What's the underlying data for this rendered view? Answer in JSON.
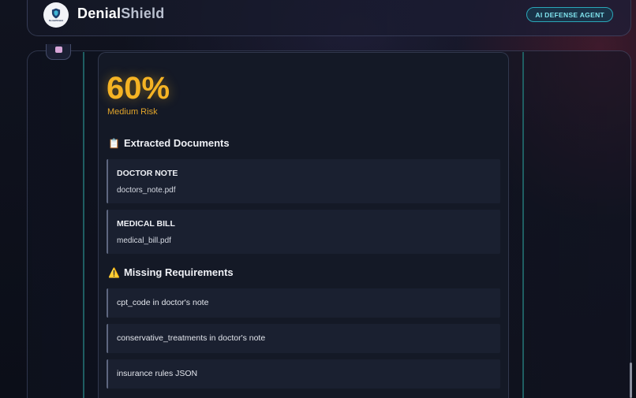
{
  "header": {
    "brand_part1": "Denial",
    "brand_part2": "Shield",
    "logo_text": "DenialShield",
    "badge": "AI DEFENSE AGENT"
  },
  "risk": {
    "percent": "60%",
    "level": "Medium Risk",
    "color": "#f5b324"
  },
  "extracted": {
    "title": "Extracted Documents",
    "icon": "clipboard-icon",
    "documents": [
      {
        "type": "DOCTOR NOTE",
        "file": "doctors_note.pdf"
      },
      {
        "type": "MEDICAL BILL",
        "file": "medical_bill.pdf"
      }
    ]
  },
  "missing": {
    "title": "Missing Requirements",
    "icon": "warning-icon",
    "items": [
      "cpt_code in doctor's note",
      "conservative_treatments in doctor's note",
      "insurance rules JSON"
    ]
  },
  "colors": {
    "accent_teal": "#2aa6b8",
    "risk_amber": "#f5b324"
  }
}
